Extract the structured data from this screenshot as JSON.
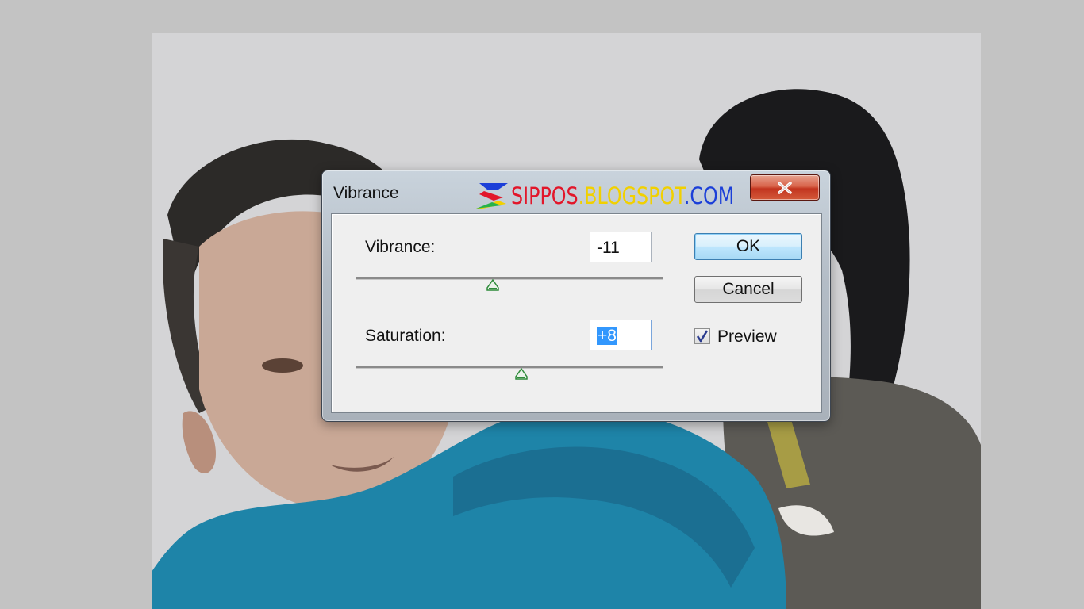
{
  "dialog": {
    "title": "Vibrance",
    "watermark": {
      "part1": "SIPPOS",
      "part2": ".BLOGSPOT",
      "part3": ".COM"
    },
    "close_icon": "close-icon"
  },
  "fields": {
    "vibrance": {
      "label": "Vibrance:",
      "value": "-11",
      "min": -100,
      "max": 100,
      "level": -11
    },
    "saturation": {
      "label": "Saturation:",
      "value": "+8",
      "min": -100,
      "max": 100,
      "level": 8
    }
  },
  "buttons": {
    "ok": "OK",
    "cancel": "Cancel"
  },
  "preview": {
    "label": "Preview",
    "checked": true
  },
  "colors": {
    "accent_selection": "#3297fd",
    "slider_thumb": "#2e8b3a",
    "close_button": "#c2351f"
  }
}
